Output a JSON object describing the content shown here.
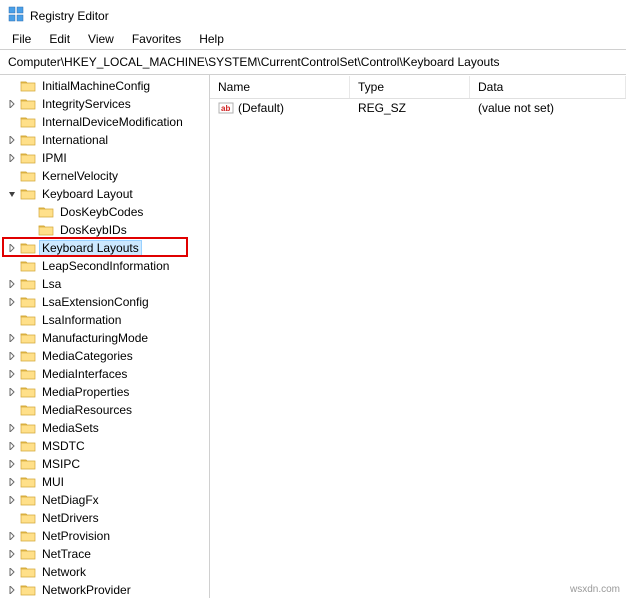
{
  "window": {
    "title": "Registry Editor"
  },
  "menu": {
    "file": "File",
    "edit": "Edit",
    "view": "View",
    "favorites": "Favorites",
    "help": "Help"
  },
  "address": {
    "path": "Computer\\HKEY_LOCAL_MACHINE\\SYSTEM\\CurrentControlSet\\Control\\Keyboard Layouts"
  },
  "tree": {
    "items": [
      {
        "label": "InitialMachineConfig",
        "indent": 1,
        "expander": ""
      },
      {
        "label": "IntegrityServices",
        "indent": 1,
        "expander": ">"
      },
      {
        "label": "InternalDeviceModification",
        "indent": 1,
        "expander": ""
      },
      {
        "label": "International",
        "indent": 1,
        "expander": ">"
      },
      {
        "label": "IPMI",
        "indent": 1,
        "expander": ">"
      },
      {
        "label": "KernelVelocity",
        "indent": 1,
        "expander": ""
      },
      {
        "label": "Keyboard Layout",
        "indent": 1,
        "expander": "v"
      },
      {
        "label": "DosKeybCodes",
        "indent": 2,
        "expander": ""
      },
      {
        "label": "DosKeybIDs",
        "indent": 2,
        "expander": ""
      },
      {
        "label": "Keyboard Layouts",
        "indent": 1,
        "expander": ">",
        "selected": true,
        "highlighted": true
      },
      {
        "label": "LeapSecondInformation",
        "indent": 1,
        "expander": ""
      },
      {
        "label": "Lsa",
        "indent": 1,
        "expander": ">"
      },
      {
        "label": "LsaExtensionConfig",
        "indent": 1,
        "expander": ">"
      },
      {
        "label": "LsaInformation",
        "indent": 1,
        "expander": ""
      },
      {
        "label": "ManufacturingMode",
        "indent": 1,
        "expander": ">"
      },
      {
        "label": "MediaCategories",
        "indent": 1,
        "expander": ">"
      },
      {
        "label": "MediaInterfaces",
        "indent": 1,
        "expander": ">"
      },
      {
        "label": "MediaProperties",
        "indent": 1,
        "expander": ">"
      },
      {
        "label": "MediaResources",
        "indent": 1,
        "expander": ""
      },
      {
        "label": "MediaSets",
        "indent": 1,
        "expander": ">"
      },
      {
        "label": "MSDTC",
        "indent": 1,
        "expander": ">"
      },
      {
        "label": "MSIPC",
        "indent": 1,
        "expander": ">"
      },
      {
        "label": "MUI",
        "indent": 1,
        "expander": ">"
      },
      {
        "label": "NetDiagFx",
        "indent": 1,
        "expander": ">"
      },
      {
        "label": "NetDrivers",
        "indent": 1,
        "expander": ""
      },
      {
        "label": "NetProvision",
        "indent": 1,
        "expander": ">"
      },
      {
        "label": "NetTrace",
        "indent": 1,
        "expander": ">"
      },
      {
        "label": "Network",
        "indent": 1,
        "expander": ">"
      },
      {
        "label": "NetworkProvider",
        "indent": 1,
        "expander": ">"
      }
    ]
  },
  "list": {
    "headers": {
      "name": "Name",
      "type": "Type",
      "data": "Data"
    },
    "rows": [
      {
        "name": "(Default)",
        "type": "REG_SZ",
        "data": "(value not set)",
        "icon": "ab"
      }
    ]
  },
  "watermark": "wsxdn.com"
}
